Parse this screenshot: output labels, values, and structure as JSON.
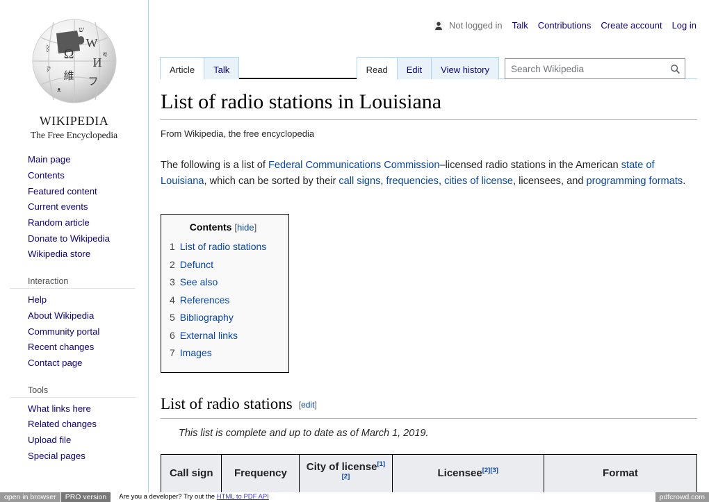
{
  "sidebar": {
    "logo": {
      "wordmark": "WIKIPEDIA",
      "tagline": "The Free Encyclopedia",
      "icon": "wikipedia-globe-logo"
    },
    "portals": [
      {
        "id": "navigation",
        "heading": "",
        "items": [
          "Main page",
          "Contents",
          "Featured content",
          "Current events",
          "Random article",
          "Donate to Wikipedia",
          "Wikipedia store"
        ]
      },
      {
        "id": "interaction",
        "heading": "Interaction",
        "items": [
          "Help",
          "About Wikipedia",
          "Community portal",
          "Recent changes",
          "Contact page"
        ]
      },
      {
        "id": "tools",
        "heading": "Tools",
        "items": [
          "What links here",
          "Related changes",
          "Upload file",
          "Special pages"
        ]
      }
    ]
  },
  "personal_tools": {
    "anon_icon": "user-avatar-icon",
    "anon_label": "Not logged in",
    "links": [
      "Talk",
      "Contributions",
      "Create account",
      "Log in"
    ]
  },
  "tabs": {
    "namespace": [
      {
        "label": "Article",
        "selected": true
      },
      {
        "label": "Talk",
        "selected": false
      }
    ],
    "views": [
      {
        "label": "Read",
        "selected": true
      },
      {
        "label": "Edit",
        "selected": false
      },
      {
        "label": "View history",
        "selected": false
      }
    ]
  },
  "search": {
    "placeholder": "Search Wikipedia",
    "value": "",
    "icon": "search-icon"
  },
  "article": {
    "title": "List of radio stations in Louisiana",
    "site_sub": "From Wikipedia, the free encyclopedia",
    "intro": {
      "part1": "The following is a list of ",
      "link1": "Federal Communications Commission",
      "part2": "–licensed radio stations in the American ",
      "link2": "state of Louisiana",
      "part3": ", which can be sorted by their ",
      "link3": "call signs",
      "part4": ", ",
      "link4": "frequencies",
      "part5": ", ",
      "link5": "cities of license",
      "part6": ", licensees, and ",
      "link6": "programming formats",
      "part7": "."
    },
    "toc": {
      "title": "Contents",
      "bracket_open": "[",
      "toggle": "hide",
      "bracket_close": "]",
      "items": [
        {
          "number": "1",
          "label": "List of radio stations"
        },
        {
          "number": "2",
          "label": "Defunct"
        },
        {
          "number": "3",
          "label": "See also"
        },
        {
          "number": "4",
          "label": "References"
        },
        {
          "number": "5",
          "label": "Bibliography"
        },
        {
          "number": "6",
          "label": "External links"
        },
        {
          "number": "7",
          "label": "Images"
        }
      ]
    },
    "section": {
      "heading": "List of radio stations",
      "edit_open": "[",
      "edit_label": "edit",
      "edit_close": "]",
      "note": "This list is complete and up to date as of March 1, 2019."
    },
    "table": {
      "columns": [
        {
          "label": "Call sign",
          "refs": []
        },
        {
          "label": "Frequency",
          "refs": []
        },
        {
          "label": "City of license",
          "refs": [
            "[1]",
            "[2]"
          ]
        },
        {
          "label": "Licensee",
          "refs": [
            "[2]",
            "[3]"
          ]
        },
        {
          "label": "Format",
          "refs": []
        }
      ]
    }
  },
  "pdf_footer": {
    "open_in_browser": "open in browser",
    "pro_version": "PRO version",
    "note_prefix": "Are you a developer? Try out the ",
    "note_link": "HTML to PDF API",
    "brand": "pdfcrowd.com"
  },
  "colors": {
    "link": "#0645ad",
    "sidebar_link": "#0b0080",
    "tab_bg": "#e8f2f8",
    "tab_border": "#a7d7f9",
    "table_header_bg": "#eaecf0"
  }
}
